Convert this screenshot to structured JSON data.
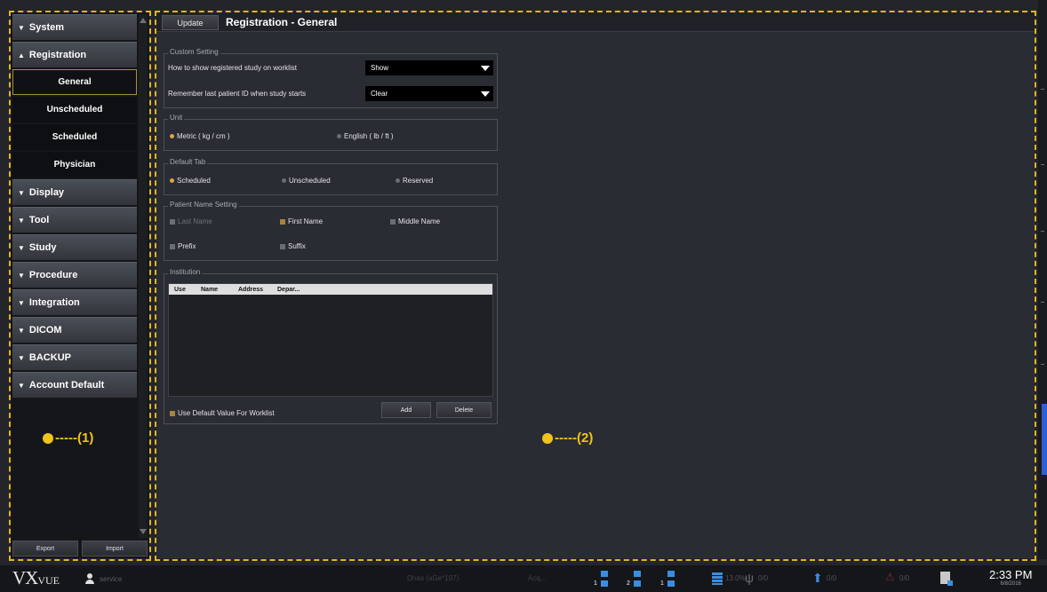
{
  "sidebar": {
    "categories": {
      "system": "System",
      "registration": "Registration",
      "display": "Display",
      "tool": "Tool",
      "study": "Study",
      "procedure": "Procedure",
      "integration": "Integration",
      "dicom": "DICOM",
      "backup": "BACKUP",
      "account_default": "Account Default"
    },
    "registration_items": [
      "General",
      "Unscheduled",
      "Scheduled",
      "Physician"
    ],
    "selected_item": "General",
    "export_label": "Export",
    "import_label": "Import"
  },
  "markers": {
    "one": "(1)",
    "two": "(2)"
  },
  "main": {
    "update_label": "Update",
    "title": "Registration - General",
    "custom_setting": {
      "title": "Custom Setting",
      "row1_label": "How to show registered study on worklist",
      "row1_value": "Show",
      "row2_label": "Remember last patient ID when study starts",
      "row2_value": "Clear"
    },
    "unit": {
      "title": "Unit",
      "metric": "Metric ( kg / cm )",
      "english": "English ( lb / ft )",
      "selected": "Metric"
    },
    "default_tab": {
      "title": "Default Tab",
      "scheduled": "Scheduled",
      "unscheduled": "Unscheduled",
      "reserved": "Reserved",
      "selected": "Scheduled"
    },
    "patient_name": {
      "title": "Patient Name Setting",
      "last_name": "Last Name",
      "first_name": "First Name",
      "middle_name": "Middle Name",
      "prefix": "Prefix",
      "suffix": "Suffix"
    },
    "institution": {
      "title": "Institution",
      "columns": [
        "Use",
        "Name",
        "Address",
        "Depar..."
      ],
      "use_default_label": "Use Default Value For Worklist",
      "add_label": "Add",
      "delete_label": "Delete"
    }
  },
  "taskbar": {
    "logo_main": "VX",
    "logo_sub": "VUE",
    "user": "service",
    "dim_text_1": "Dhaa (aGe*197)",
    "dim_text_2": "Acq...",
    "net_labels": [
      "1",
      "2",
      "1"
    ],
    "storage": "13.0%",
    "usb_count": "0/0",
    "upload_count": "0/0",
    "warn_count": "0/0",
    "time": "2:33 PM",
    "date": "6/8/2016"
  },
  "colors": {
    "accent": "#f0c419",
    "radio_on": "#e0a24a",
    "taskbar_blue": "#3b8de0"
  }
}
